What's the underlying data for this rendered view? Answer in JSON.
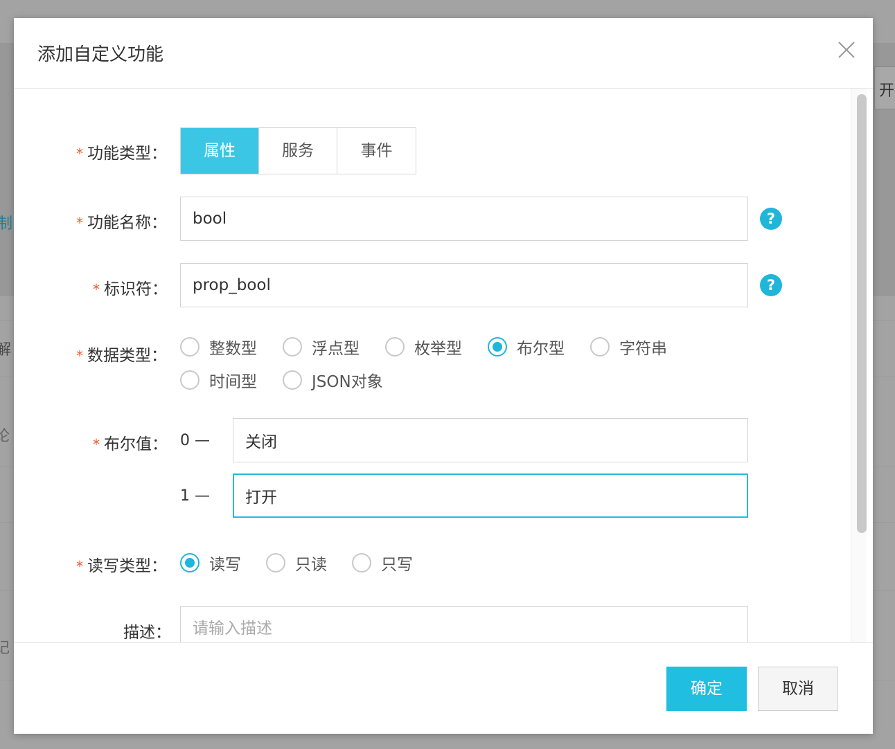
{
  "background": {
    "button_label": "开",
    "text_fragments": [
      "制",
      "解",
      "论",
      "记"
    ]
  },
  "modal": {
    "title": "添加自定义功能",
    "close_icon": "close-icon"
  },
  "form": {
    "function_type": {
      "label": "功能类型：",
      "options": [
        "属性",
        "服务",
        "事件"
      ],
      "selected": "属性"
    },
    "function_name": {
      "label": "功能名称：",
      "value": "bool"
    },
    "identifier": {
      "label": "标识符：",
      "value": "prop_bool"
    },
    "data_type": {
      "label": "数据类型：",
      "options": [
        "整数型",
        "浮点型",
        "枚举型",
        "布尔型",
        "字符串",
        "时间型",
        "JSON对象"
      ],
      "selected": "布尔型"
    },
    "bool_value": {
      "label": "布尔值：",
      "zero_prefix": "0 —",
      "zero_value": "关闭",
      "one_prefix": "1 —",
      "one_value": "打开"
    },
    "rw_type": {
      "label": "读写类型：",
      "options": [
        "读写",
        "只读",
        "只写"
      ],
      "selected": "读写"
    },
    "description": {
      "label": "描述：",
      "placeholder": "请输入描述",
      "value": ""
    },
    "required_mark": "*",
    "help_glyph": "?"
  },
  "footer": {
    "confirm_label": "确定",
    "cancel_label": "取消"
  },
  "colors": {
    "accent": "#20bee0",
    "required": "#f05a28",
    "overlay": "#8f8f8f"
  }
}
